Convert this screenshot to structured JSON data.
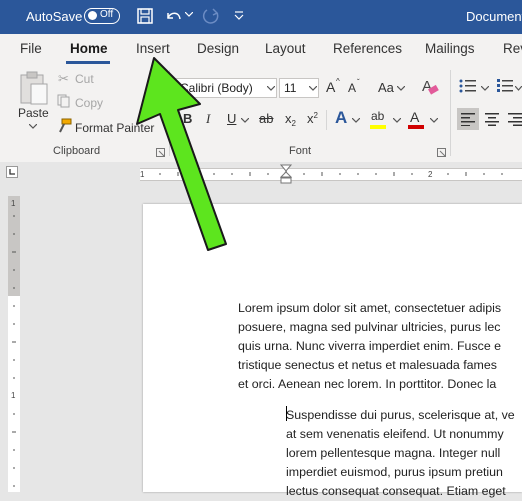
{
  "titlebar": {
    "autosave_label": "AutoSave",
    "autosave_state": "Off",
    "doc_title": "Document"
  },
  "tabs": [
    "File",
    "Home",
    "Insert",
    "Design",
    "Layout",
    "References",
    "Mailings",
    "Rev"
  ],
  "clipboard": {
    "paste_label": "Paste",
    "cut_label": "Cut",
    "copy_label": "Copy",
    "format_painter_label": "Format Painter",
    "group_label": "Clipboard"
  },
  "font": {
    "font_name": "Calibri (Body)",
    "font_size": "11",
    "case_label": "Aa",
    "group_label": "Font",
    "bold": "B",
    "italic": "I",
    "underline": "U",
    "strike": "ab",
    "subscript": "x",
    "superscript": "x",
    "sub_mark": "2",
    "sup_mark": "2",
    "text_effects": "A",
    "highlight": "ab",
    "font_color": "A",
    "grow": "A",
    "shrink": "A"
  },
  "document": {
    "para1": [
      "Lorem ipsum dolor sit amet, consectetuer adipis",
      "posuere, magna sed pulvinar ultricies, purus lec",
      "quis urna. Nunc viverra imperdiet enim. Fusce e",
      "tristique senectus et netus et malesuada fames",
      "et orci. Aenean nec lorem. In porttitor. Donec la"
    ],
    "para2": [
      "Suspendisse dui purus, scelerisque at, ve",
      "at sem venenatis eleifend. Ut nonummy",
      "lorem pellentesque magna. Integer null",
      "imperdiet euismod, purus ipsum pretiun",
      "lectus consequat consequat. Etiam eget"
    ]
  },
  "colors": {
    "titlebar": "#2b579a",
    "arrow_fill": "#5de51e",
    "highlight_bar": "#ffff00",
    "font_color_bar": "#d00000"
  }
}
